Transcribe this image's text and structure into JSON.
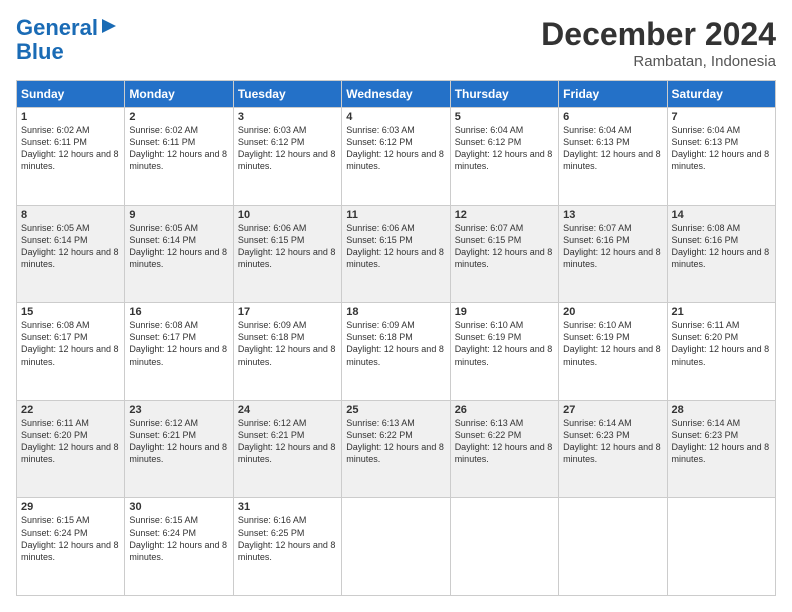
{
  "header": {
    "logo_line1": "General",
    "logo_line2": "Blue",
    "month_title": "December 2024",
    "location": "Rambatan, Indonesia"
  },
  "weekdays": [
    "Sunday",
    "Monday",
    "Tuesday",
    "Wednesday",
    "Thursday",
    "Friday",
    "Saturday"
  ],
  "weeks": [
    [
      {
        "day": "1",
        "sunrise": "6:02 AM",
        "sunset": "6:11 PM",
        "daylight": "12 hours and 8 minutes."
      },
      {
        "day": "2",
        "sunrise": "6:02 AM",
        "sunset": "6:11 PM",
        "daylight": "12 hours and 8 minutes."
      },
      {
        "day": "3",
        "sunrise": "6:03 AM",
        "sunset": "6:12 PM",
        "daylight": "12 hours and 8 minutes."
      },
      {
        "day": "4",
        "sunrise": "6:03 AM",
        "sunset": "6:12 PM",
        "daylight": "12 hours and 8 minutes."
      },
      {
        "day": "5",
        "sunrise": "6:04 AM",
        "sunset": "6:12 PM",
        "daylight": "12 hours and 8 minutes."
      },
      {
        "day": "6",
        "sunrise": "6:04 AM",
        "sunset": "6:13 PM",
        "daylight": "12 hours and 8 minutes."
      },
      {
        "day": "7",
        "sunrise": "6:04 AM",
        "sunset": "6:13 PM",
        "daylight": "12 hours and 8 minutes."
      }
    ],
    [
      {
        "day": "8",
        "sunrise": "6:05 AM",
        "sunset": "6:14 PM",
        "daylight": "12 hours and 8 minutes."
      },
      {
        "day": "9",
        "sunrise": "6:05 AM",
        "sunset": "6:14 PM",
        "daylight": "12 hours and 8 minutes."
      },
      {
        "day": "10",
        "sunrise": "6:06 AM",
        "sunset": "6:15 PM",
        "daylight": "12 hours and 8 minutes."
      },
      {
        "day": "11",
        "sunrise": "6:06 AM",
        "sunset": "6:15 PM",
        "daylight": "12 hours and 8 minutes."
      },
      {
        "day": "12",
        "sunrise": "6:07 AM",
        "sunset": "6:15 PM",
        "daylight": "12 hours and 8 minutes."
      },
      {
        "day": "13",
        "sunrise": "6:07 AM",
        "sunset": "6:16 PM",
        "daylight": "12 hours and 8 minutes."
      },
      {
        "day": "14",
        "sunrise": "6:08 AM",
        "sunset": "6:16 PM",
        "daylight": "12 hours and 8 minutes."
      }
    ],
    [
      {
        "day": "15",
        "sunrise": "6:08 AM",
        "sunset": "6:17 PM",
        "daylight": "12 hours and 8 minutes."
      },
      {
        "day": "16",
        "sunrise": "6:08 AM",
        "sunset": "6:17 PM",
        "daylight": "12 hours and 8 minutes."
      },
      {
        "day": "17",
        "sunrise": "6:09 AM",
        "sunset": "6:18 PM",
        "daylight": "12 hours and 8 minutes."
      },
      {
        "day": "18",
        "sunrise": "6:09 AM",
        "sunset": "6:18 PM",
        "daylight": "12 hours and 8 minutes."
      },
      {
        "day": "19",
        "sunrise": "6:10 AM",
        "sunset": "6:19 PM",
        "daylight": "12 hours and 8 minutes."
      },
      {
        "day": "20",
        "sunrise": "6:10 AM",
        "sunset": "6:19 PM",
        "daylight": "12 hours and 8 minutes."
      },
      {
        "day": "21",
        "sunrise": "6:11 AM",
        "sunset": "6:20 PM",
        "daylight": "12 hours and 8 minutes."
      }
    ],
    [
      {
        "day": "22",
        "sunrise": "6:11 AM",
        "sunset": "6:20 PM",
        "daylight": "12 hours and 8 minutes."
      },
      {
        "day": "23",
        "sunrise": "6:12 AM",
        "sunset": "6:21 PM",
        "daylight": "12 hours and 8 minutes."
      },
      {
        "day": "24",
        "sunrise": "6:12 AM",
        "sunset": "6:21 PM",
        "daylight": "12 hours and 8 minutes."
      },
      {
        "day": "25",
        "sunrise": "6:13 AM",
        "sunset": "6:22 PM",
        "daylight": "12 hours and 8 minutes."
      },
      {
        "day": "26",
        "sunrise": "6:13 AM",
        "sunset": "6:22 PM",
        "daylight": "12 hours and 8 minutes."
      },
      {
        "day": "27",
        "sunrise": "6:14 AM",
        "sunset": "6:23 PM",
        "daylight": "12 hours and 8 minutes."
      },
      {
        "day": "28",
        "sunrise": "6:14 AM",
        "sunset": "6:23 PM",
        "daylight": "12 hours and 8 minutes."
      }
    ],
    [
      {
        "day": "29",
        "sunrise": "6:15 AM",
        "sunset": "6:24 PM",
        "daylight": "12 hours and 8 minutes."
      },
      {
        "day": "30",
        "sunrise": "6:15 AM",
        "sunset": "6:24 PM",
        "daylight": "12 hours and 8 minutes."
      },
      {
        "day": "31",
        "sunrise": "6:16 AM",
        "sunset": "6:25 PM",
        "daylight": "12 hours and 8 minutes."
      },
      null,
      null,
      null,
      null
    ]
  ]
}
